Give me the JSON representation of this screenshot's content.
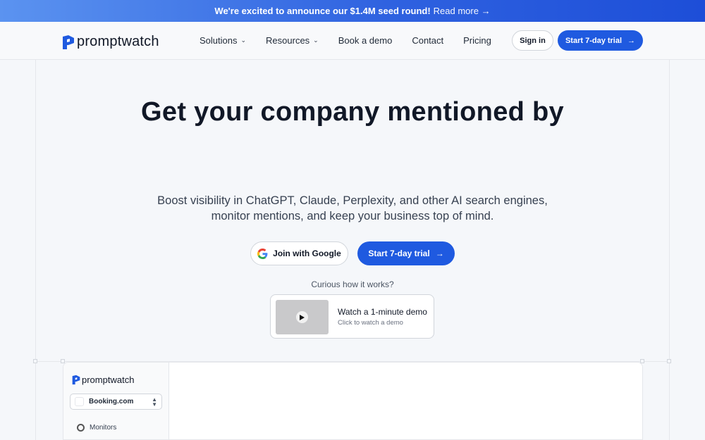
{
  "announcement": {
    "bold": "We're excited to announce our $1.4M seed round!",
    "link": "Read more →"
  },
  "brand": {
    "name": "promptwatch",
    "accent": "#1f5ae0"
  },
  "nav": {
    "items": [
      {
        "label": "Solutions",
        "has_dropdown": true
      },
      {
        "label": "Resources",
        "has_dropdown": true
      },
      {
        "label": "Book a demo",
        "has_dropdown": false
      },
      {
        "label": "Contact",
        "has_dropdown": false
      },
      {
        "label": "Pricing",
        "has_dropdown": false
      }
    ],
    "sign_in": "Sign in",
    "trial": "Start 7-day trial"
  },
  "hero": {
    "title": "Get your company mentioned by",
    "subtitle_line1": "Boost visibility in ChatGPT, Claude, Perplexity, and other AI search engines,",
    "subtitle_line2": "monitor mentions, and keep your business top of mind.",
    "google_button": "Join with Google",
    "trial_button": "Start 7-day trial",
    "curious": "Curious how it works?",
    "demo_title": "Watch a 1-minute demo",
    "demo_sub": "Click to watch a demo"
  },
  "app_preview": {
    "brand": "promptwatch",
    "selected_site": "Booking.com",
    "menu_item": "Monitors"
  }
}
